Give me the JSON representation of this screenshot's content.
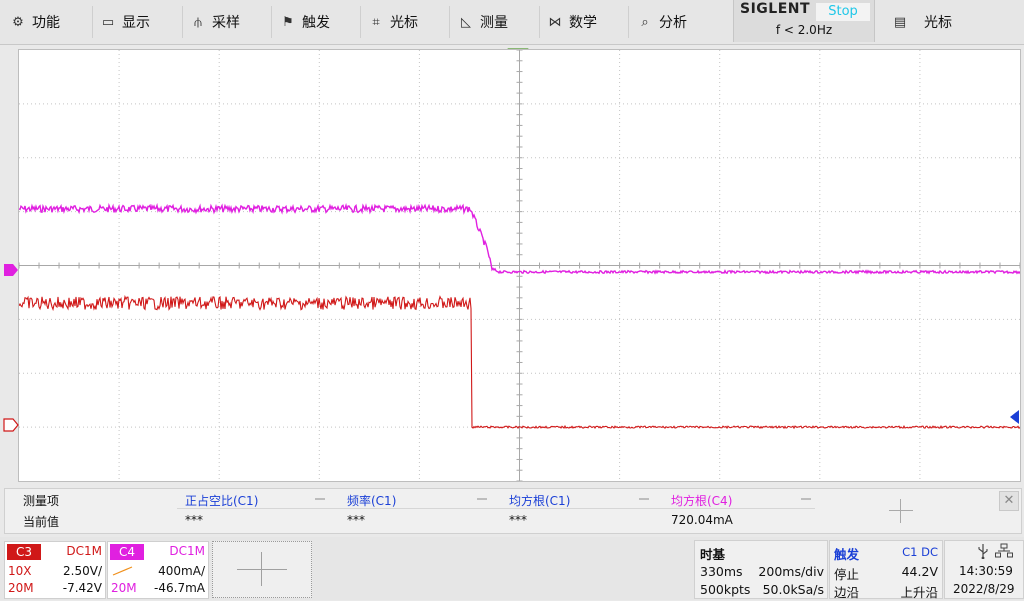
{
  "menu": {
    "items": [
      {
        "label": "功能",
        "icon": "gear-icon",
        "glyph": "⚙"
      },
      {
        "label": "显示",
        "icon": "monitor-icon",
        "glyph": "▭"
      },
      {
        "label": "采样",
        "icon": "acquire-icon",
        "glyph": "⫛"
      },
      {
        "label": "触发",
        "icon": "flag-icon",
        "glyph": "⚑"
      },
      {
        "label": "光标",
        "icon": "crosshair-icon",
        "glyph": "⌗"
      },
      {
        "label": "测量",
        "icon": "ruler-icon",
        "glyph": "◺"
      },
      {
        "label": "数学",
        "icon": "math-icon",
        "glyph": "⋈"
      },
      {
        "label": "分析",
        "icon": "analyze-icon",
        "glyph": "⌕"
      }
    ],
    "right_item": {
      "label": "光标",
      "icon": "document-icon",
      "glyph": "▤"
    }
  },
  "brand": "SIGLENT",
  "run_state": "Stop",
  "trigger_freq": "f < 2.0Hz",
  "colors": {
    "c3": "#d01818",
    "c4": "#e020e0",
    "measure_blue": "#1a3fd6",
    "run_cyan": "#1fc7e8",
    "trigger_orange": "#f0901c"
  },
  "waveforms": {
    "c4": {
      "level_before": 1.05,
      "level_after": -0.12,
      "fall_start": 0.451
    },
    "c3": {
      "level_before": -0.7,
      "level_after": -3.0,
      "fall_at": 0.452
    }
  },
  "measure": {
    "row_label_1": "测量项",
    "row_label_2": "当前值",
    "columns": [
      {
        "name": "正占空比(C1)",
        "value": "***",
        "color": "blue"
      },
      {
        "name": "频率(C1)",
        "value": "***",
        "color": "blue"
      },
      {
        "name": "均方根(C1)",
        "value": "***",
        "color": "blue"
      },
      {
        "name": "均方根(C4)",
        "value": "720.04mA",
        "color": "magenta"
      }
    ]
  },
  "channels": {
    "c3": {
      "tag": "C3",
      "coupling": "DC1M",
      "probe": "10X",
      "scale": "2.50V/",
      "bw": "20M",
      "offset": "-7.42V"
    },
    "c4": {
      "tag": "C4",
      "coupling": "DC1M",
      "scale": "400mA/",
      "bw": "20M",
      "offset": "-46.7mA"
    }
  },
  "timebase": {
    "title": "时基",
    "delay": "330ms",
    "scale": "200ms/div",
    "memory": "500kpts",
    "rate": "50.0kSa/s"
  },
  "trigger": {
    "title": "触发",
    "source": "C1 DC",
    "state": "停止",
    "level": "44.2V",
    "type": "边沿",
    "slope": "上升沿"
  },
  "clock": {
    "time": "14:30:59",
    "date": "2022/8/29"
  }
}
